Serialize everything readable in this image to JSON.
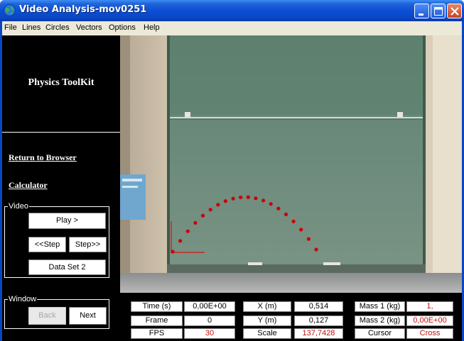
{
  "window": {
    "title": "Video Analysis-mov0251",
    "icons": {
      "app": "globe-icon",
      "minimize": "minimize-icon",
      "maximize": "maximize-icon",
      "close": "close-icon"
    }
  },
  "menu": [
    "File",
    "Lines",
    "Circles",
    "Vectors",
    "Options",
    "Help"
  ],
  "sidebar": {
    "brand": "Physics ToolKit",
    "links": [
      "Return to Browser",
      "Calculator"
    ],
    "video_group": {
      "label": "Video",
      "play": "Play >",
      "step_back": "<<Step",
      "step_forward": "Step>>",
      "data_set": "Data Set  2"
    },
    "window_group": {
      "label": "Window",
      "back": "Back",
      "next": "Next"
    }
  },
  "video": {
    "trajectory_points": 20,
    "marker_color": "#cc0000",
    "axis_color": "#e01010"
  },
  "data_panel": {
    "rows": [
      [
        {
          "label": "Time (s)",
          "value": "0,00E+00",
          "value_color": "black"
        },
        {
          "label": "X (m)",
          "value": "0,514",
          "value_color": "black"
        },
        {
          "label": "Mass 1 (kg)",
          "value": "1,",
          "value_color": "red"
        }
      ],
      [
        {
          "label": "Frame",
          "value": "0",
          "value_color": "black"
        },
        {
          "label": "Y (m)",
          "value": "0,127",
          "value_color": "black"
        },
        {
          "label": "Mass 2 (kg)",
          "value": "0,00E+00",
          "value_color": "red"
        }
      ],
      [
        {
          "label": "FPS",
          "value": "30",
          "value_color": "red"
        },
        {
          "label": "Scale",
          "value": "137,7428",
          "value_color": "red"
        },
        {
          "label": "Cursor",
          "value": "Cross",
          "value_color": "red"
        }
      ]
    ]
  }
}
